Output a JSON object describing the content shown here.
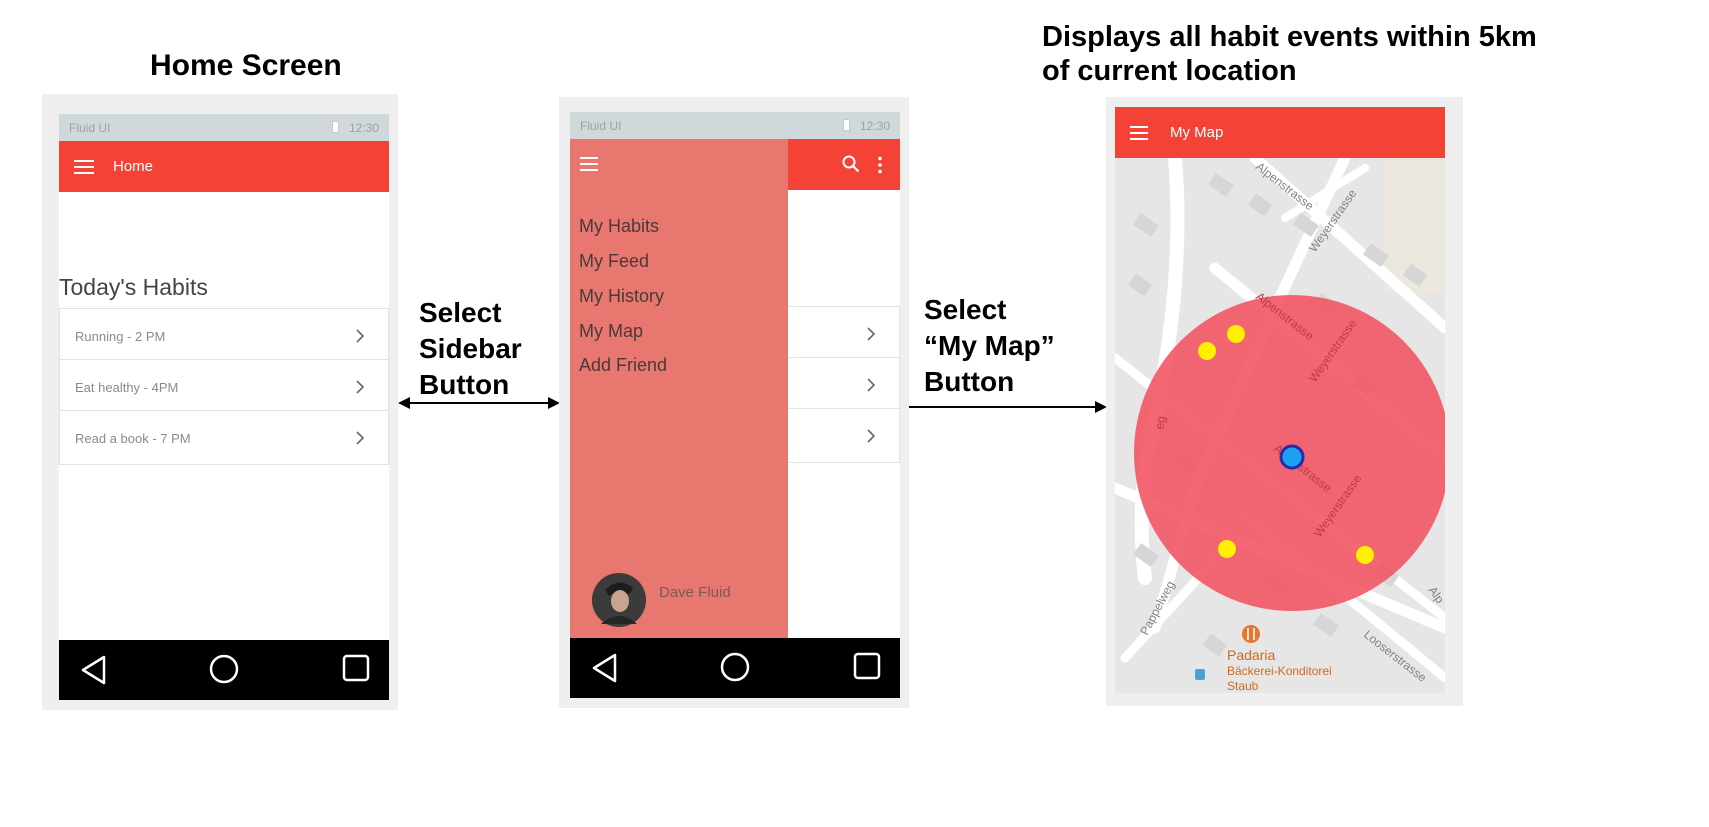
{
  "diagram": {
    "home_title": "Home Screen",
    "map_caption_line1": "Displays all habit events within 5km",
    "map_caption_line2": "of current location",
    "arrow1_label": [
      "Select",
      "Sidebar",
      "Button"
    ],
    "arrow2_label": [
      "Select",
      "“My Map”",
      "Button"
    ]
  },
  "status": {
    "carrier": "Fluid UI",
    "time": "12:30"
  },
  "home": {
    "appbar_title": "Home",
    "section_title": "Today's Habits",
    "habits": [
      "Running - 2 PM",
      "Eat healthy - 4PM",
      "Read a book - 7 PM"
    ]
  },
  "drawer": {
    "items": [
      "My Habits",
      "My Feed",
      "My History",
      "My Map",
      "Add Friend"
    ],
    "user_name": "Dave Fluid"
  },
  "map": {
    "appbar_title": "My Map",
    "streets": [
      "Alpenstrasse",
      "Weyerstrasse",
      "Alpenstrasse",
      "Weyerstrasse",
      "Alpenstrasse",
      "Weyerstrasse",
      "Pappelweg",
      "Looserstrasse",
      "Alp",
      "eg"
    ],
    "poi_name": "Padaria",
    "poi_sub1": "Bäckerei-Konditorei",
    "poi_sub2": "Staub",
    "colors": {
      "radius": "#f25766",
      "event_marker": "#ffef00",
      "user_marker": "#1da1f2",
      "poi": "#e8762b"
    }
  },
  "colors": {
    "accent": "#f44336",
    "drawer": "#e8776f"
  }
}
